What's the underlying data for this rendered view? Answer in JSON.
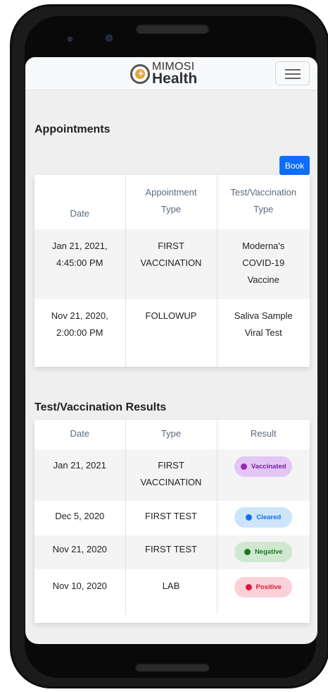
{
  "brand": {
    "line1": "MIMOSI",
    "line2": "Health"
  },
  "appointments": {
    "title": "Appointments",
    "book_label": "Book",
    "columns": [
      "Date",
      "Appointment Type",
      "Test/Vaccination Type"
    ],
    "rows": [
      {
        "date": "Jan 21, 2021, 4:45:00 PM",
        "type": "FIRST VACCINATION",
        "test": "Moderna's COVID-19 Vaccine"
      },
      {
        "date": "Nov 21, 2020, 2:00:00 PM",
        "type": "FOLLOWUP",
        "test": "Saliva Sample Viral Test"
      }
    ]
  },
  "results": {
    "title": "Test/Vaccination Results",
    "columns": [
      "Date",
      "Type",
      "Result"
    ],
    "rows": [
      {
        "date": "Jan 21, 2021",
        "type": "FIRST VACCINATION",
        "result": "Vaccinated"
      },
      {
        "date": "Dec 5, 2020",
        "type": "FIRST TEST",
        "result": "Cleared"
      },
      {
        "date": "Nov 21, 2020",
        "type": "FIRST TEST",
        "result": "Negative"
      },
      {
        "date": "Nov 10, 2020",
        "type": "LAB",
        "result": "Positive"
      }
    ]
  },
  "colors": {
    "accent": "#0d6efd",
    "vaccinated_bg": "#e3c6f5",
    "vaccinated_fg": "#7b1fa2",
    "cleared_bg": "#cde4fb",
    "cleared_fg": "#0d6efd",
    "negative_bg": "#cfe8cf",
    "negative_fg": "#1b7a1b",
    "positive_bg": "#fbd0d8",
    "positive_fg": "#d81b3c"
  }
}
